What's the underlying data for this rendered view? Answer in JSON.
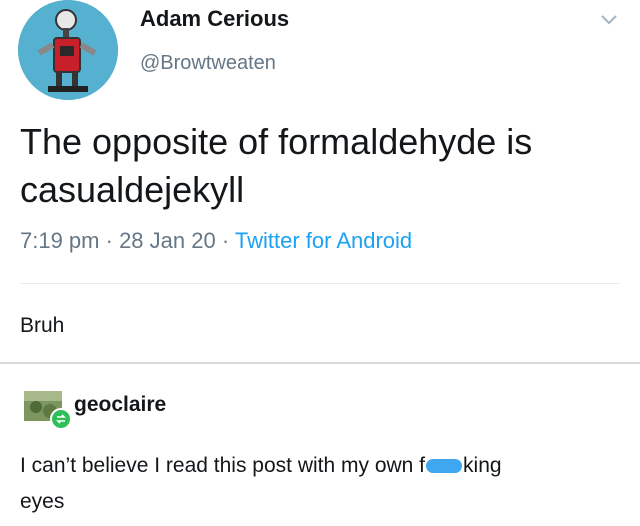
{
  "tweet": {
    "author_name": "Adam Cerious",
    "author_handle": "@Browtweaten",
    "text_line1": "The opposite of formaldehyde is",
    "text_line2": "casualdejekyll",
    "time": "7:19 pm",
    "sep1": " · ",
    "date": "28 Jan 20",
    "sep2": " · ",
    "source": "Twitter for Android",
    "chevron_icon": "chevron-down-icon"
  },
  "first_reply": {
    "text": "Bruh"
  },
  "reblog": {
    "username": "geoclaire",
    "badge_icon": "reblog-icon",
    "text_before": "I can’t believe I read this post with my own f",
    "text_after": "king",
    "text_line2": "eyes",
    "censor_color": "#3fa6f0"
  },
  "colors": {
    "link": "#1da1f2",
    "muted": "#657786",
    "avatar_bg": "#4ea8c8"
  }
}
